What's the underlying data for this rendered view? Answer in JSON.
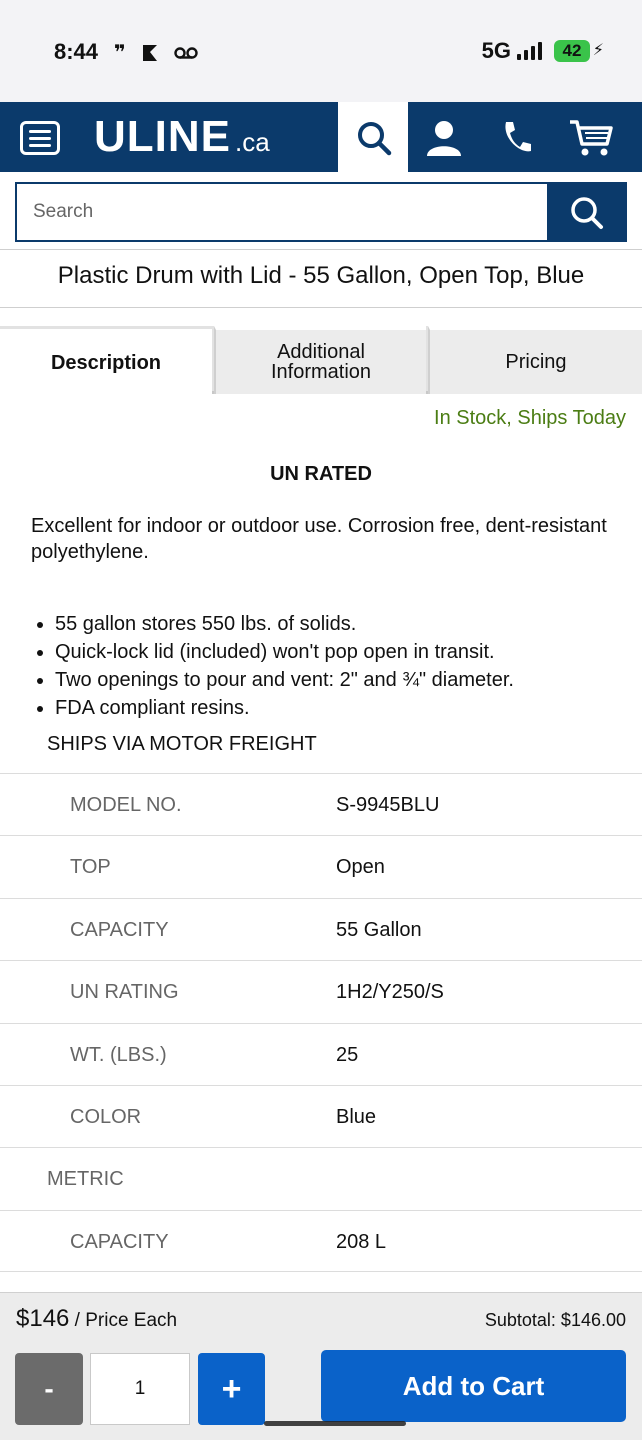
{
  "status_bar": {
    "time": "8:44",
    "network": "5G",
    "battery": "42",
    "icons": [
      "quote-icon",
      "k-icon",
      "voicemail-icon",
      "signal-icon",
      "battery-icon",
      "charging-icon"
    ]
  },
  "header": {
    "logo": "ULINE",
    "logo_suffix": ".ca",
    "icons": [
      "menu-icon",
      "search-icon",
      "account-icon",
      "phone-icon",
      "cart-icon"
    ],
    "brand_color": "#0b3a6b"
  },
  "search": {
    "placeholder": "Search"
  },
  "product": {
    "title": "Plastic Drum with Lid - 55 Gallon, Open Top, Blue"
  },
  "tabs": {
    "description": "Description",
    "additional_line1": "Additional",
    "additional_line2": "Information",
    "pricing": "Pricing",
    "active": "Description"
  },
  "description": {
    "stock": "In Stock, Ships Today",
    "stock_color": "#4b7d14",
    "heading": "UN RATED",
    "text": "Excellent for indoor or outdoor use. Corrosion free, dent-resistant polyethylene.",
    "bullets": [
      "55 gallon stores 550 lbs. of solids.",
      "Quick-lock lid (included) won't pop open in transit.",
      "Two openings to pour and vent: 2\" and ¾\" diameter.",
      "FDA compliant resins."
    ],
    "shipping": "SHIPS VIA MOTOR FREIGHT"
  },
  "specs": [
    {
      "label": "MODEL NO.",
      "value": "S-9945BLU"
    },
    {
      "label": "TOP",
      "value": "Open"
    },
    {
      "label": "CAPACITY",
      "value": "55 Gallon"
    },
    {
      "label": "UN RATING",
      "value": "1H2/Y250/S"
    },
    {
      "label": "WT. (LBS.)",
      "value": "25"
    },
    {
      "label": "COLOR",
      "value": "Blue"
    },
    {
      "label": "METRIC",
      "value": ""
    },
    {
      "label": "CAPACITY",
      "value": "208 L"
    }
  ],
  "footer": {
    "price": "$146",
    "price_suffix": " / Price Each",
    "subtotal": "Subtotal: $146.00",
    "minus": "-",
    "quantity": "1",
    "plus": "+",
    "add_to_cart": "Add to Cart",
    "accent_color": "#0a62c9"
  }
}
